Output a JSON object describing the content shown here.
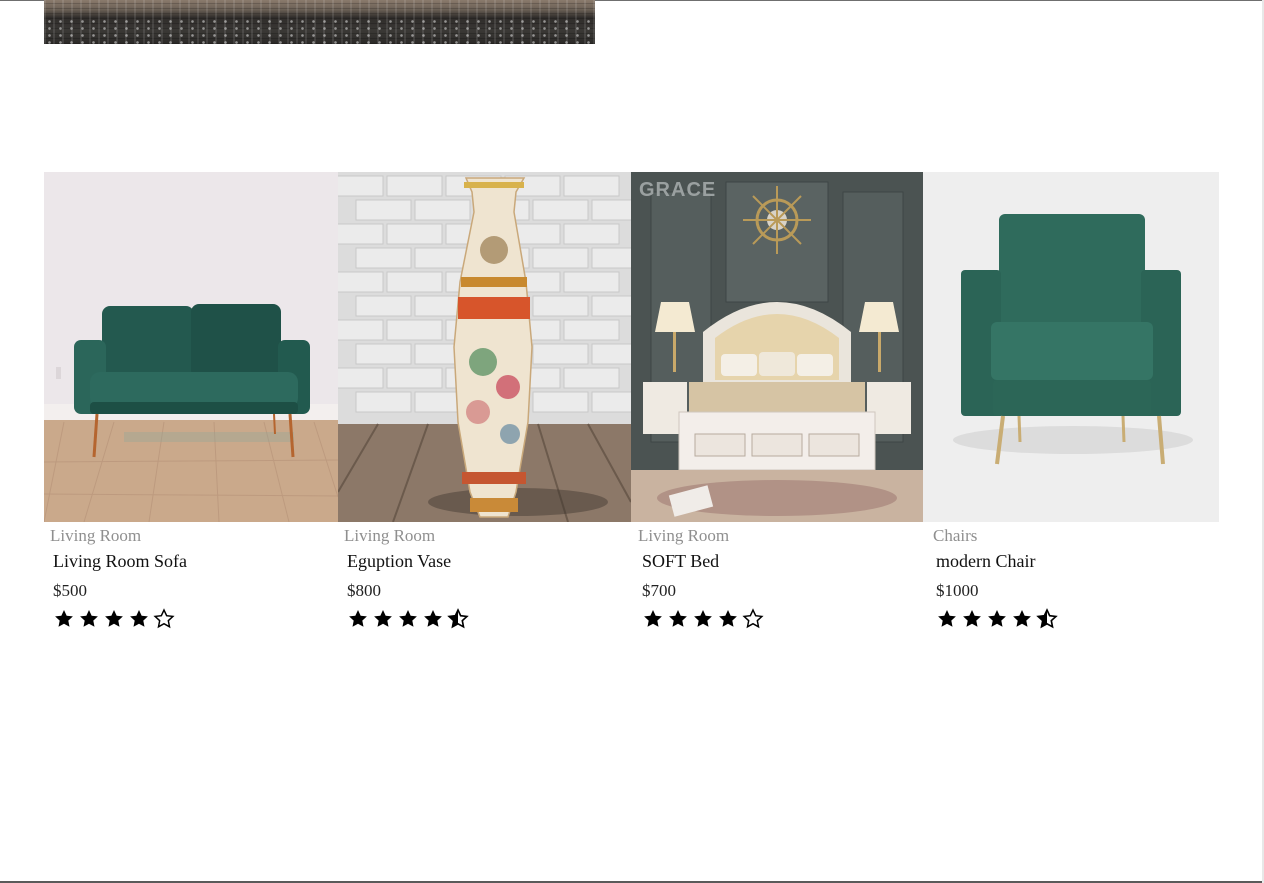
{
  "products": [
    {
      "category": "Living Room",
      "name": "Living Room Sofa",
      "price": "$500",
      "rating": 4,
      "image": "green-velvet-sofa"
    },
    {
      "category": "Living Room",
      "name": "Eguption Vase",
      "price": "$800",
      "rating": 4.5,
      "image": "painted-floor-vase"
    },
    {
      "category": "Living Room",
      "name": "SOFT Bed",
      "price": "$700",
      "rating": 4,
      "image": "tufted-bed-bedroom"
    },
    {
      "category": "Chairs",
      "name": "modern Chair",
      "price": "$1000",
      "rating": 4.5,
      "image": "green-armchair"
    }
  ],
  "bed_image_logo": "GRACE",
  "icons": {
    "star_full": "star-icon",
    "star_half": "star-half-icon",
    "star_empty": "star-outline-icon"
  }
}
